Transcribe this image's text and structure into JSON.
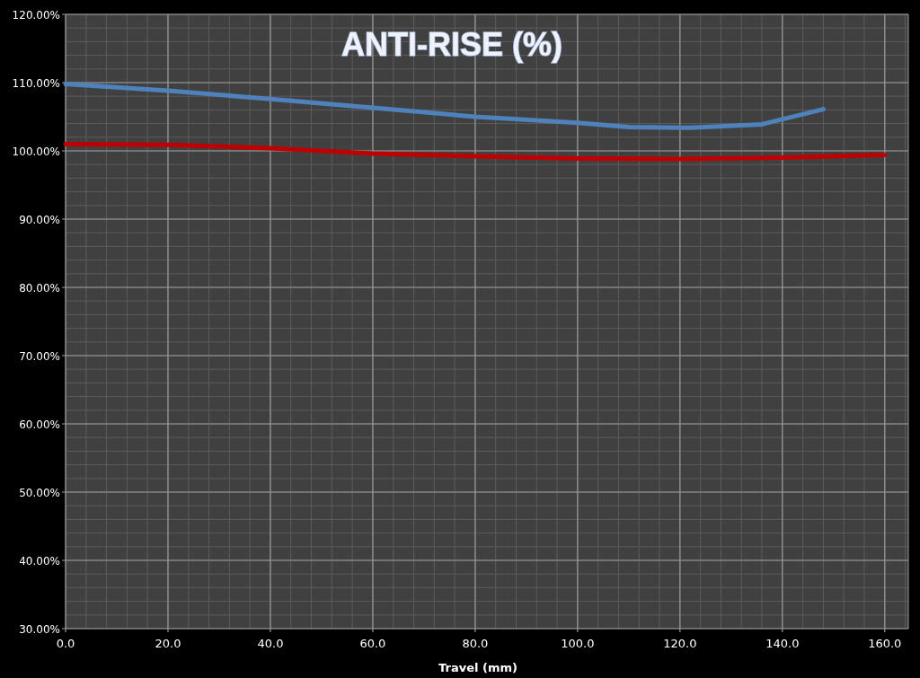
{
  "chart_data": {
    "type": "line",
    "title": "ANTI-RISE (%)",
    "xlabel": "Travel (mm)",
    "series": [
      {
        "color": "#4f81bd",
        "x": [
          0,
          20,
          40,
          60,
          80,
          100,
          110,
          122,
          136,
          148
        ],
        "values": [
          1.098,
          1.088,
          1.076,
          1.063,
          1.05,
          1.041,
          1.035,
          1.034,
          1.039,
          1.061
        ]
      },
      {
        "color": "#c00000",
        "x": [
          0,
          20,
          40,
          60,
          80,
          100,
          120,
          140,
          160
        ],
        "values": [
          1.01,
          1.009,
          1.004,
          0.996,
          0.992,
          0.989,
          0.988,
          0.99,
          0.994
        ]
      }
    ],
    "grid": true,
    "xlim": [
      0,
      164.6
    ],
    "ylim": [
      0.3,
      1.2
    ],
    "xticks": [
      {
        "value": 0,
        "label": "0.0"
      },
      {
        "value": 20,
        "label": "20.0"
      },
      {
        "value": 40,
        "label": "40.0"
      },
      {
        "value": 60,
        "label": "60.0"
      },
      {
        "value": 80,
        "label": "80.0"
      },
      {
        "value": 100,
        "label": "100.0"
      },
      {
        "value": 120,
        "label": "120.0"
      },
      {
        "value": 140,
        "label": "140.0"
      },
      {
        "value": 160,
        "label": "160.0"
      }
    ],
    "yticks": [
      {
        "value": 0.3,
        "label": "30.00%"
      },
      {
        "value": 0.4,
        "label": "40.00%"
      },
      {
        "value": 0.5,
        "label": "50.00%"
      },
      {
        "value": 0.6,
        "label": "60.00%"
      },
      {
        "value": 0.7,
        "label": "70.00%"
      },
      {
        "value": 0.8,
        "label": "80.00%"
      },
      {
        "value": 0.9,
        "label": "90.00%"
      },
      {
        "value": 1.0,
        "label": "100.00%"
      },
      {
        "value": 1.1,
        "label": "110.00%"
      },
      {
        "value": 1.2,
        "label": "120.00%"
      }
    ]
  }
}
